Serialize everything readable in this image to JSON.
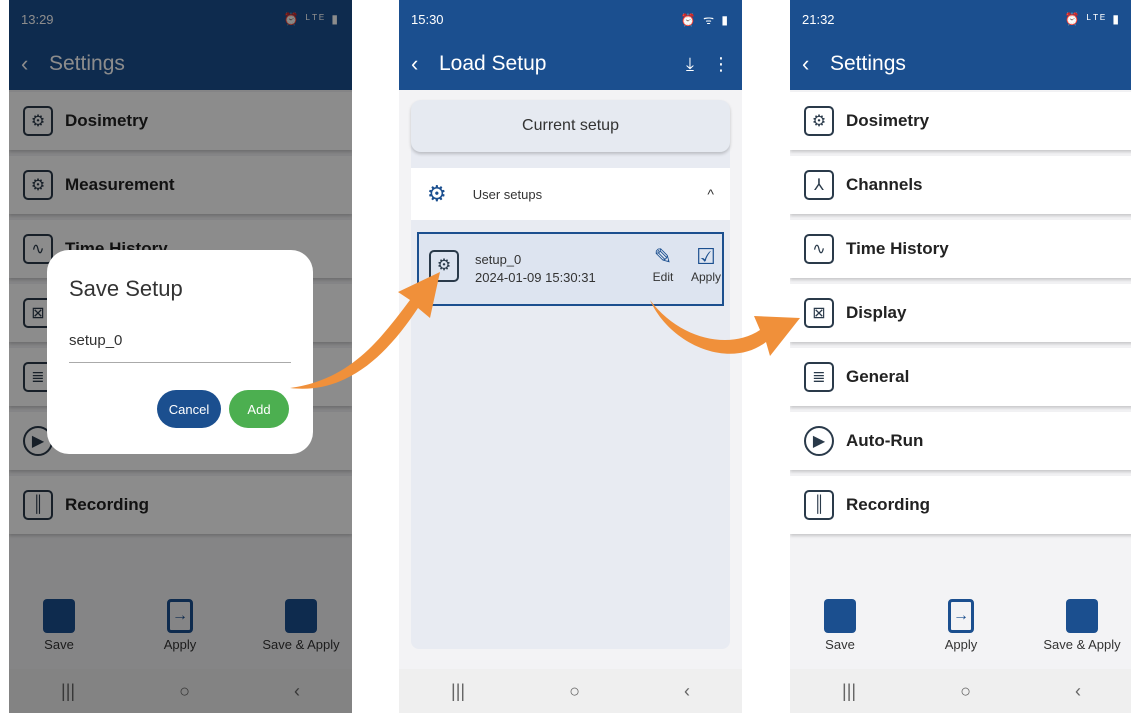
{
  "screen1": {
    "status_time": "13:29",
    "status_icons": "⏰ ᴸᵀᴱ ▮",
    "back_glyph": "‹",
    "title": "Settings",
    "items": [
      {
        "label": "Dosimetry",
        "icon": "⚙"
      },
      {
        "label": "Measurement",
        "icon": "⚙"
      },
      {
        "label": "Time History",
        "icon": "∿"
      },
      {
        "label": "",
        "icon": "⊠"
      },
      {
        "label": "",
        "icon": "≣"
      },
      {
        "label": "",
        "icon": "▶"
      },
      {
        "label": "Recording",
        "icon": "║"
      }
    ],
    "dialog": {
      "title": "Save Setup",
      "value": "setup_0",
      "cancel": "Cancel",
      "add": "Add"
    },
    "bottom": {
      "save": "Save",
      "apply": "Apply",
      "save_apply": "Save & Apply"
    },
    "nav": [
      "|||",
      "○",
      "‹"
    ]
  },
  "screen2": {
    "status_time": "15:30",
    "status_icons": "⏰ ᯤ ▮",
    "back_glyph": "‹",
    "title": "Load Setup",
    "download_icon": "⤓",
    "menu_icon": "⋮",
    "current_setup": "Current setup",
    "group_label": "User setups",
    "group_chevron": "^",
    "setup_name": "setup_0",
    "setup_date": "2024-01-09 15:30:31",
    "edit_label": "Edit",
    "apply_label": "Apply",
    "edit_glyph": "✎",
    "apply_glyph": "☑",
    "nav": [
      "|||",
      "○",
      "‹"
    ]
  },
  "screen3": {
    "status_time": "21:32",
    "status_icons": "⏰ ᴸᵀᴱ ▮",
    "back_glyph": "‹",
    "title": "Settings",
    "items": [
      {
        "label": "Dosimetry",
        "icon": "⚙"
      },
      {
        "label": "Channels",
        "icon": "⅄"
      },
      {
        "label": "Time History",
        "icon": "∿"
      },
      {
        "label": "Display",
        "icon": "⊠"
      },
      {
        "label": "General",
        "icon": "≣"
      },
      {
        "label": "Auto-Run",
        "icon": "▶"
      },
      {
        "label": "Recording",
        "icon": "║"
      }
    ],
    "bottom": {
      "save": "Save",
      "apply": "Apply",
      "save_apply": "Save & Apply"
    },
    "nav": [
      "|||",
      "○",
      "‹"
    ]
  },
  "colors": {
    "primary": "#1b4f8f",
    "add_green": "#4caf50",
    "arrow": "#f0903a"
  }
}
